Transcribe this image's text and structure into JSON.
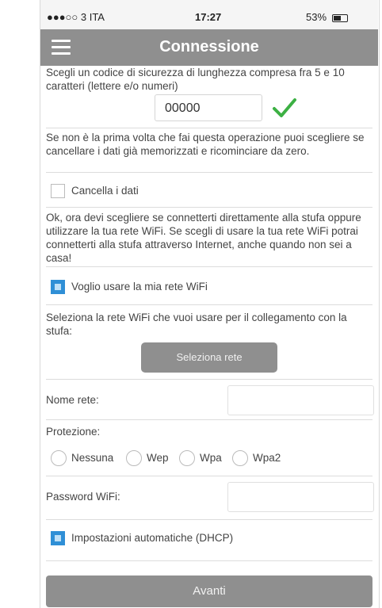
{
  "status_bar": {
    "carrier": "●●●○○ 3 ITA",
    "time": "17:27",
    "battery": "53%"
  },
  "header": {
    "title": "Connessione"
  },
  "security": {
    "instruction": "Scegli un codice di sicurezza di lunghezza compresa fra 5 e 10 caratteri (lettere e/o numeri)",
    "code_value": "00000"
  },
  "reset": {
    "instruction": "Se non è la prima volta che fai questa operazione puoi scegliere se cancellare i dati già memorizzati e ricominciare da zero.",
    "checkbox_label": "Cancella i dati",
    "checked": false
  },
  "wifi": {
    "instruction": "Ok, ora devi scegliere se connetterti direttamente alla stufa oppure utilizzare la tua rete WiFi. Se scegli di usare la tua rete WiFi potrai connetterti alla stufa attraverso Internet, anche quando non sei a casa!",
    "checkbox_label": "Voglio usare la mia rete WiFi",
    "checked": true
  },
  "network": {
    "instruction": "Seleziona la rete WiFi che vuoi usare per il collegamento con la stufa:",
    "select_button": "Seleziona rete",
    "name_label": "Nome rete:",
    "name_value": "",
    "protection_label": "Protezione:",
    "protection_options": [
      "Nessuna",
      "Wep",
      "Wpa",
      "Wpa2"
    ],
    "password_label": "Password WiFi:",
    "password_value": ""
  },
  "dhcp": {
    "checkbox_label": "Impostazioni automatiche (DHCP)",
    "checked": true
  },
  "footer": {
    "next_button": "Avanti"
  },
  "colors": {
    "nav_bg": "#8f8f8f",
    "accent_blue": "#2f8fd6",
    "check_green": "#3cb043"
  }
}
